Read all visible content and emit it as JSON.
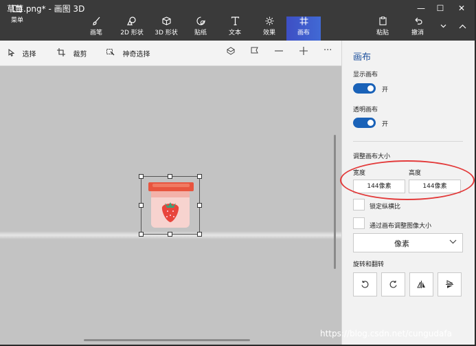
{
  "window": {
    "title": "草莓.png* - 画图 3D",
    "minimize": "—",
    "maximize": "☐",
    "close": "✕"
  },
  "ribbon": {
    "menu": {
      "label": "菜单",
      "icon": "folder-icon"
    },
    "tools": [
      {
        "label": "画笔",
        "icon": "brush-icon"
      },
      {
        "label": "2D 形状",
        "icon": "shapes-2d-icon"
      },
      {
        "label": "3D 形状",
        "icon": "cube-icon"
      },
      {
        "label": "贴纸",
        "icon": "sticker-icon"
      },
      {
        "label": "文本",
        "icon": "text-icon"
      },
      {
        "label": "效果",
        "icon": "effects-icon"
      },
      {
        "label": "画布",
        "icon": "canvas-icon",
        "active": true
      }
    ],
    "paste": {
      "label": "粘贴"
    },
    "undo": {
      "label": "撤消"
    }
  },
  "toolbar": {
    "select_label": "选择",
    "crop_label": "裁剪",
    "magic_select_label": "神奇选择",
    "more": "···"
  },
  "panel": {
    "title": "画布",
    "show_canvas_label": "显示画布",
    "show_canvas_state": "开",
    "transparent_canvas_label": "透明画布",
    "transparent_canvas_state": "开",
    "resize_label": "调整画布大小",
    "width_label": "宽度",
    "height_label": "高度",
    "width_value": "144像素",
    "height_value": "144像素",
    "lock_ratio_label": "锁定纵横比",
    "resize_image_label": "通过画布调整图像大小",
    "unit_value": "像素",
    "rotate_label": "旋转和翻转"
  },
  "colors": {
    "accent": "#1a62b8",
    "ribbon_bg": "#3a3a3a",
    "active_tab": "#3d4fc4",
    "highlight_ellipse": "#e33a3a",
    "canvas_bg": "#c3c3c3"
  },
  "watermark": "https://blog.csdn.net/cungudafa"
}
